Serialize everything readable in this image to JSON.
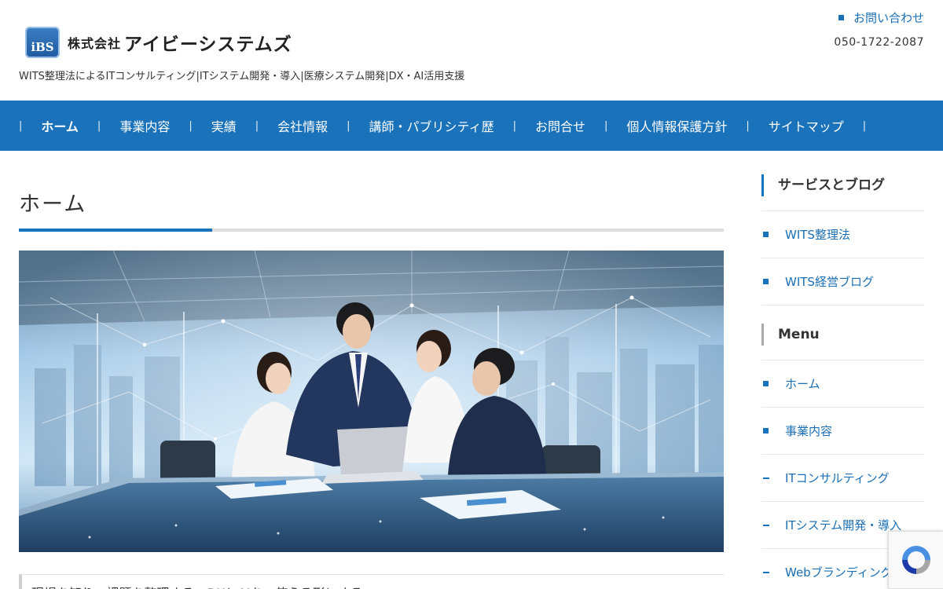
{
  "header": {
    "logo_small": "株式会社",
    "logo_big": "アイビーシステムズ",
    "logo_badge": "iBS",
    "tagline": "WITS整理法によるITコンサルティング|ITシステム開発・導入|医療システム開発|DX・AI活用支援",
    "contact_label": "お問い合わせ",
    "phone": "050-1722-2087"
  },
  "nav": {
    "items": [
      {
        "label": "ホーム",
        "active": true
      },
      {
        "label": "事業内容"
      },
      {
        "label": "実績"
      },
      {
        "label": "会社情報"
      },
      {
        "label": "講師・パブリシティ歴"
      },
      {
        "label": "お問合せ"
      },
      {
        "label": "個人情報保護方針"
      },
      {
        "label": "サイトマップ"
      }
    ],
    "separator": "|"
  },
  "main": {
    "title": "ホーム",
    "lead": "現場を知り、課題を整理する。DXとAIを、使える形にする。"
  },
  "sidebar": {
    "widget1": {
      "title": "サービスとブログ",
      "items": [
        "WITS整理法",
        "WITS経営ブログ"
      ]
    },
    "widget2": {
      "title": "Menu",
      "items": [
        {
          "label": "ホーム",
          "marker": "square"
        },
        {
          "label": "事業内容",
          "marker": "square"
        },
        {
          "label": "ITコンサルティング",
          "marker": "dash"
        },
        {
          "label": "ITシステム開発・導入",
          "marker": "dash"
        },
        {
          "label": "Webブランディング",
          "marker": "dash"
        }
      ]
    }
  },
  "colors": {
    "brand_blue": "#1a72ba",
    "link_blue": "#1a6fb5"
  },
  "icons": {
    "logo": "ibs-logo-icon",
    "recaptcha": "recaptcha-icon"
  }
}
